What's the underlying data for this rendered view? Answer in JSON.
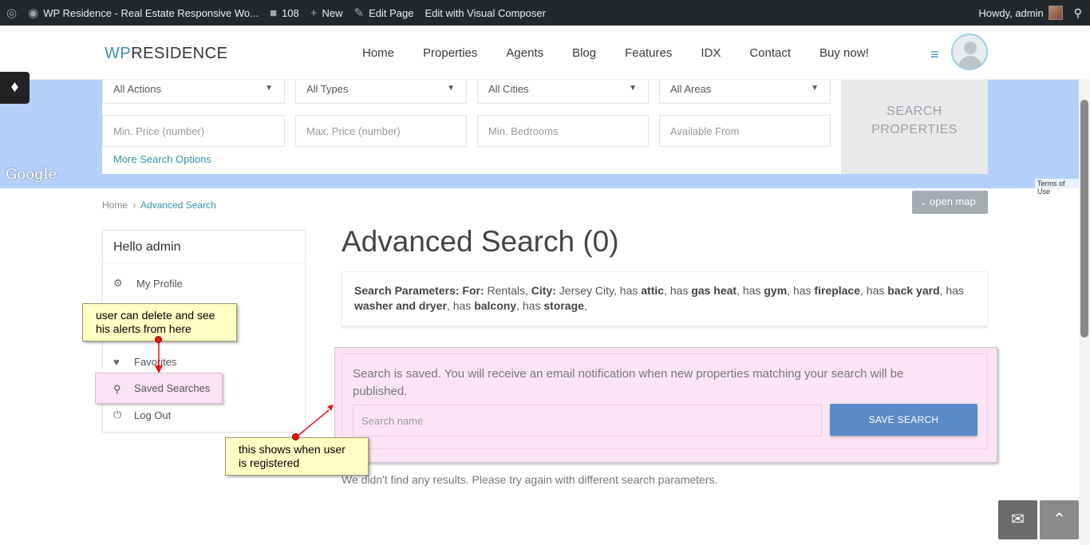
{
  "adminbar": {
    "site_title": "WP Residence - Real Estate Responsive Wo...",
    "comments_count": "108",
    "new_label": "New",
    "edit_page_label": "Edit Page",
    "visual_composer_label": "Edit with Visual Composer",
    "howdy": "Howdy, admin"
  },
  "header": {
    "logo_wp": "WP",
    "logo_rest": "RESIDENCE",
    "nav": [
      "Home",
      "Properties",
      "Agents",
      "Blog",
      "Features",
      "IDX",
      "Contact",
      "Buy now!"
    ]
  },
  "search": {
    "actions": "All Actions",
    "types": "All Types",
    "cities": "All Cities",
    "areas": "All Areas",
    "min_price": "Min. Price (number)",
    "max_price": "Max. Price (number)",
    "min_bedrooms": "Min. Bedrooms",
    "available_from": "Available From",
    "more_options": "More Search Options",
    "button_line1": "SEARCH",
    "button_line2": "PROPERTIES"
  },
  "map": {
    "google": "Google",
    "terms": "Terms of Use",
    "open_map": "open map"
  },
  "breadcrumb": {
    "home": "Home",
    "separator": "›",
    "current": "Advanced Search"
  },
  "usermenu": {
    "hello": "Hello admin",
    "my_profile": "My Profile",
    "favorites": "Favorites",
    "saved_searches": "Saved Searches",
    "log_out": "Log Out"
  },
  "main": {
    "title": "Advanced Search (0)",
    "params": {
      "label": "Search Parameters:",
      "for_label": "For:",
      "for_value": "Rentals,",
      "city_label": "City:",
      "city_value": "Jersey City,",
      "has": "has",
      "features": [
        "attic",
        "gas heat",
        "gym",
        "fireplace",
        "back yard",
        "washer and dryer",
        "balcony",
        "storage"
      ]
    },
    "saved_message": "Search is saved. You will receive an email notification when new properties matching your search will be published.",
    "search_name_placeholder": "Search name",
    "save_button": "SAVE SEARCH",
    "no_results": "We didn't find any results. Please try again with different search parameters."
  },
  "callouts": {
    "alerts_note": "user can delete and see his alerts from here",
    "registered_note": "this shows when user is registered"
  },
  "colors": {
    "accent": "#3a8fb7",
    "save_button": "#5b8bc7",
    "map_bg": "#b5d0fb",
    "pink": "#fce4f5",
    "callout": "#ffffc4"
  }
}
